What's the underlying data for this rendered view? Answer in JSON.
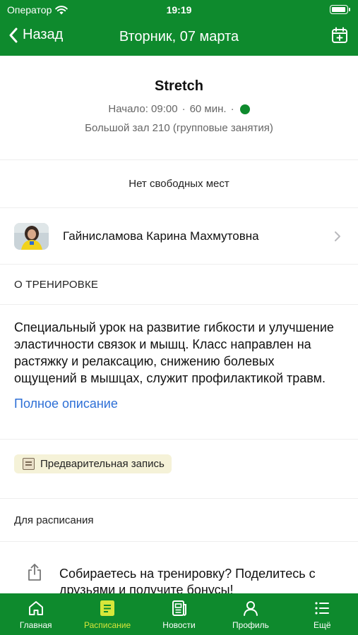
{
  "status_bar": {
    "carrier": "Оператор",
    "time": "19:19"
  },
  "nav": {
    "back_label": "Назад",
    "title": "Вторник, 07 марта",
    "calendar_icon": "calendar-plus-icon"
  },
  "workout": {
    "title": "Stretch",
    "start": "Начало: 09:00",
    "separator": "·",
    "duration": "60 мин.",
    "status_color": "#0e8a2d",
    "room": "Большой зал 210 (групповые занятия)"
  },
  "availability": "Нет свободных мест",
  "trainer": {
    "name": "Гайнисламова Карина Махмутовна"
  },
  "about": {
    "heading": "О ТРЕНИРОВКЕ",
    "text": "Специальный урок на развитие гибкости и улучшение эластичности связок и мышц. Класс направлен на растяжку и релаксацию, снижению болевых ощущений в мышцах, служит профилактикой травм.",
    "full_link": "Полное описание"
  },
  "tag": {
    "label": "Предварительная запись",
    "icon": "clipboard-icon"
  },
  "for_schedule": "Для расписания",
  "share": {
    "text": "Собираетесь на тренировку? Поделитесь с друзьями и получите бонусы!"
  },
  "tabs": [
    {
      "label": "Главная",
      "icon": "home-icon",
      "active": false
    },
    {
      "label": "Расписание",
      "icon": "schedule-icon",
      "active": true
    },
    {
      "label": "Новости",
      "icon": "news-icon",
      "active": false
    },
    {
      "label": "Профиль",
      "icon": "profile-icon",
      "active": false
    },
    {
      "label": "Ещё",
      "icon": "more-list-icon",
      "active": false
    }
  ],
  "colors": {
    "brand_green": "#0e8a2d",
    "active_tab": "#d7e63a",
    "link_blue": "#2d6fd6",
    "tag_bg": "#f5f2d8"
  }
}
